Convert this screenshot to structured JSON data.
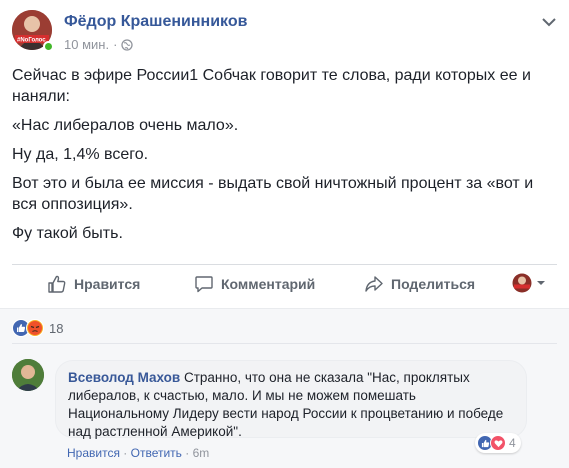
{
  "post": {
    "author": "Фёдор Крашенинников",
    "time": "10 мин.",
    "separator": "·",
    "avatar_badge": "#NoГолос",
    "paragraphs": [
      "Сейчас в эфире России1 Собчак говорит те слова, ради которых ее и наняли:",
      "«Нас либералов очень мало».",
      "Ну да, 1,4% всего.",
      "Вот это и была ее миссия - выдать свой ничтожный процент за «вот и вся оппозиция».",
      "Фу такой быть."
    ]
  },
  "actions": {
    "like": "Нравится",
    "comment": "Комментарий",
    "share": "Поделиться"
  },
  "reactions": {
    "count": "18"
  },
  "comment": {
    "author": "Всеволод Махов",
    "text": " Странно, что она не сказала \"Нас, проклятых либералов, к счастью, мало. И мы не можем помешать Национальному Лидеру вести народ России к процветанию и победе над растленной Америкой\".",
    "reaction_count": "4",
    "like_link": "Нравится",
    "reply_link": "Ответить",
    "dot": " · ",
    "time": "6m"
  },
  "colors": {
    "accent": "#365899",
    "like_blue": "#4267b2",
    "angry": "#f7b125",
    "love": "#f25268",
    "online": "#42b72a"
  }
}
